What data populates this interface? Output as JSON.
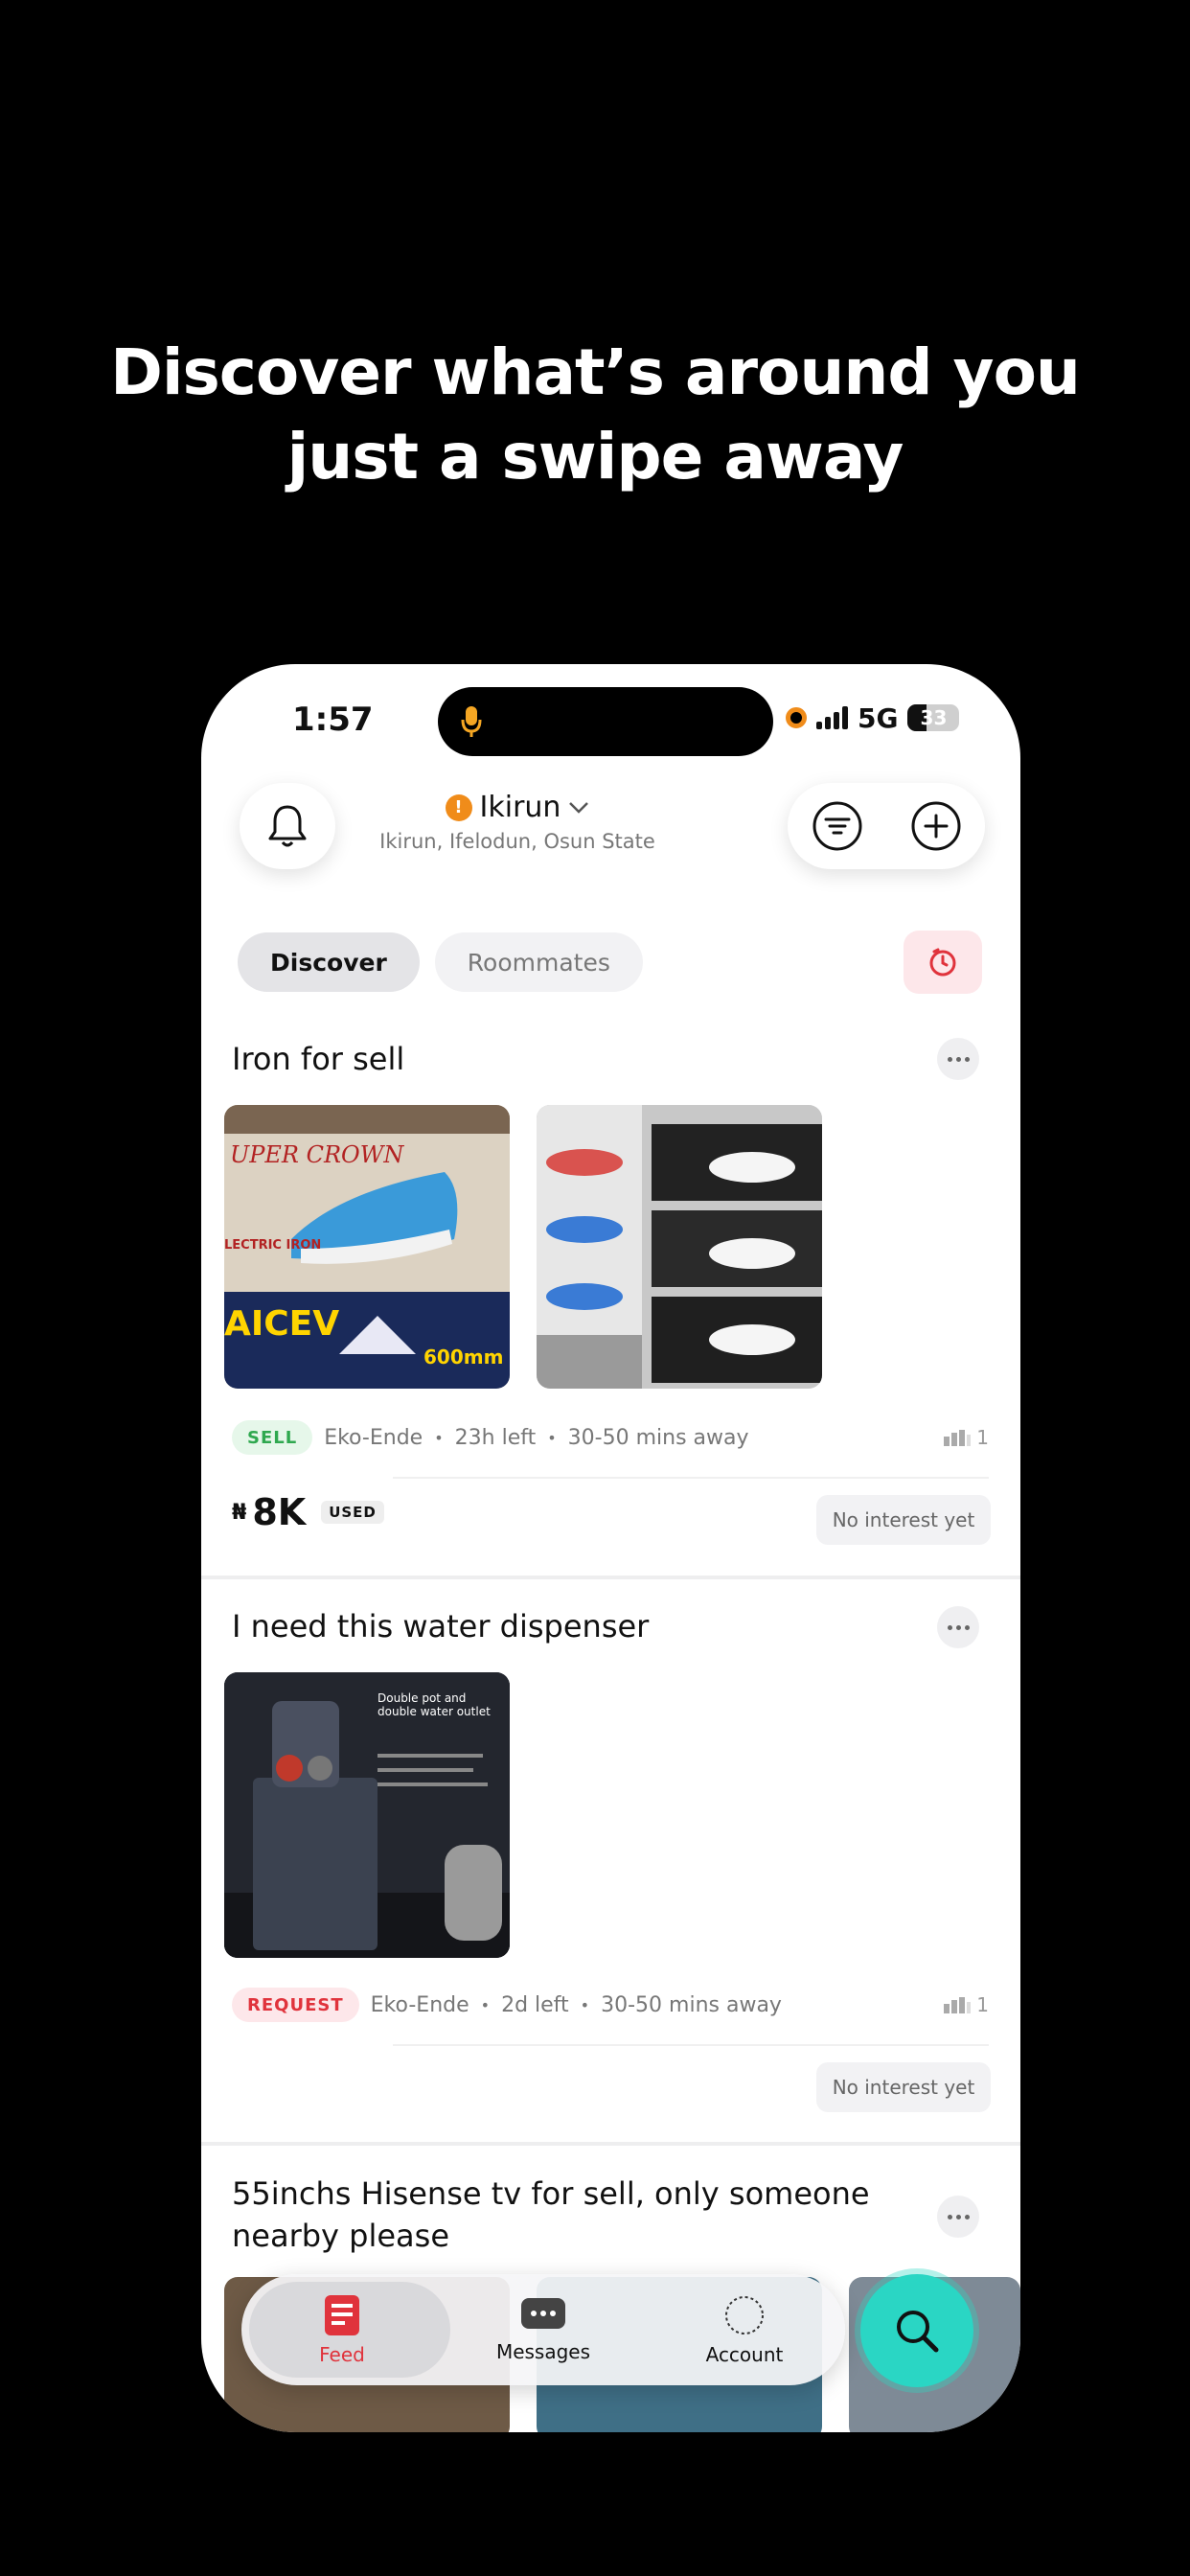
{
  "headline": {
    "line1": "Discover what’s around you",
    "line2": "just a swipe away"
  },
  "status_bar": {
    "time": "1:57",
    "network": "5G",
    "battery": "33"
  },
  "header": {
    "location_badge": "!",
    "location_name": "Ikirun",
    "location_detail": "Ikirun, Ifelodun, Osun State"
  },
  "tabs": [
    {
      "label": "Discover",
      "active": true
    },
    {
      "label": "Roommates",
      "active": false
    }
  ],
  "posts": [
    {
      "title": "Iron for sell",
      "tag": "SELL",
      "area": "Eko-Ende",
      "time_left": "23h left",
      "distance": "30-50 mins away",
      "views": "1",
      "currency": "₦",
      "price": "8K",
      "condition": "USED",
      "interest": "No interest yet",
      "images": [
        {
          "text1": "UPER CROWN",
          "text2": "LECTRIC IRON",
          "text3": "AICEV",
          "text4": "600mm"
        },
        {
          "text1": "",
          "text2": "",
          "text3": "",
          "text4": ""
        }
      ]
    },
    {
      "title": "I need this water dispenser",
      "tag": "REQUEST",
      "area": "Eko-Ende",
      "time_left": "2d left",
      "distance": "30-50 mins away",
      "views": "1",
      "interest": "No interest yet",
      "image_text": "Double pot and double water outlet"
    },
    {
      "title": "55inchs Hisense tv for sell, only someone nearby please"
    }
  ],
  "nav": {
    "items": [
      {
        "label": "Feed",
        "icon": "feed-icon",
        "active": true
      },
      {
        "label": "Messages",
        "icon": "messages-icon",
        "active": false
      },
      {
        "label": "Account",
        "icon": "account-icon",
        "active": false
      }
    ]
  },
  "colors": {
    "accent_red": "#e0333c",
    "accent_teal": "#2ad6c4",
    "orange": "#f08c1a",
    "sell_green": "#2fa84f"
  }
}
